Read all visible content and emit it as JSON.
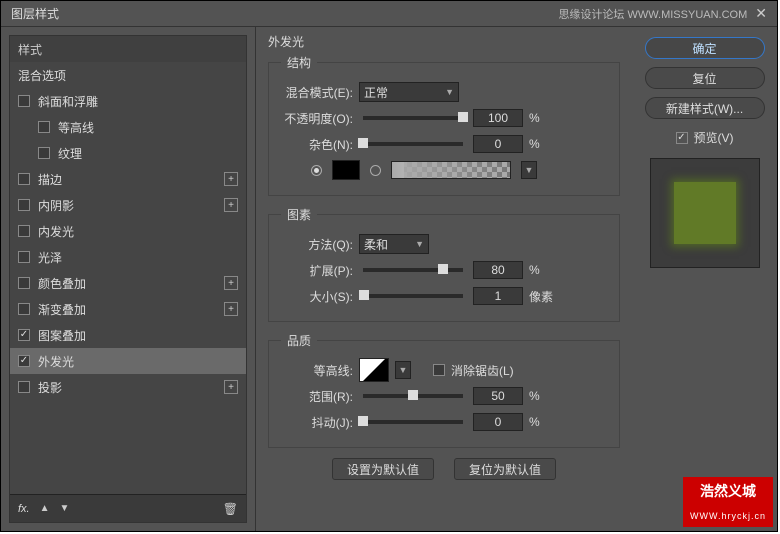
{
  "titlebar": {
    "title": "图层样式",
    "site": "思缘设计论坛  WWW.MISSYUAN.COM"
  },
  "sidebar": {
    "styles_header": "样式",
    "blend_options": "混合选项",
    "items": [
      {
        "label": "斜面和浮雕",
        "checked": false,
        "plus": false
      },
      {
        "label": "等高线",
        "checked": false,
        "indent": true
      },
      {
        "label": "纹理",
        "checked": false,
        "indent": true
      },
      {
        "label": "描边",
        "checked": false,
        "plus": true
      },
      {
        "label": "内阴影",
        "checked": false,
        "plus": true
      },
      {
        "label": "内发光",
        "checked": false
      },
      {
        "label": "光泽",
        "checked": false
      },
      {
        "label": "颜色叠加",
        "checked": false,
        "plus": true
      },
      {
        "label": "渐变叠加",
        "checked": false,
        "plus": true
      },
      {
        "label": "图案叠加",
        "checked": true
      },
      {
        "label": "外发光",
        "checked": true,
        "selected": true
      },
      {
        "label": "投影",
        "checked": false,
        "plus": true
      }
    ],
    "footer_fx": "fx."
  },
  "settings": {
    "title": "外发光",
    "structure": {
      "legend": "结构",
      "blend_mode_label": "混合模式(E):",
      "blend_mode_value": "正常",
      "opacity_label": "不透明度(O):",
      "opacity_value": "100",
      "opacity_unit": "%",
      "noise_label": "杂色(N):",
      "noise_value": "0",
      "noise_unit": "%"
    },
    "elements": {
      "legend": "图素",
      "technique_label": "方法(Q):",
      "technique_value": "柔和",
      "spread_label": "扩展(P):",
      "spread_value": "80",
      "spread_unit": "%",
      "size_label": "大小(S):",
      "size_value": "1",
      "size_unit": "像素"
    },
    "quality": {
      "legend": "品质",
      "contour_label": "等高线:",
      "antialias_label": "消除锯齿(L)",
      "range_label": "范围(R):",
      "range_value": "50",
      "range_unit": "%",
      "jitter_label": "抖动(J):",
      "jitter_value": "0",
      "jitter_unit": "%"
    },
    "buttons": {
      "default": "设置为默认值",
      "reset": "复位为默认值"
    }
  },
  "right": {
    "ok": "确定",
    "cancel": "复位",
    "new_style": "新建样式(W)...",
    "preview": "预览(V)"
  },
  "badge": {
    "top": "浩然义城",
    "bot": "WWW.hryckj.cn"
  }
}
